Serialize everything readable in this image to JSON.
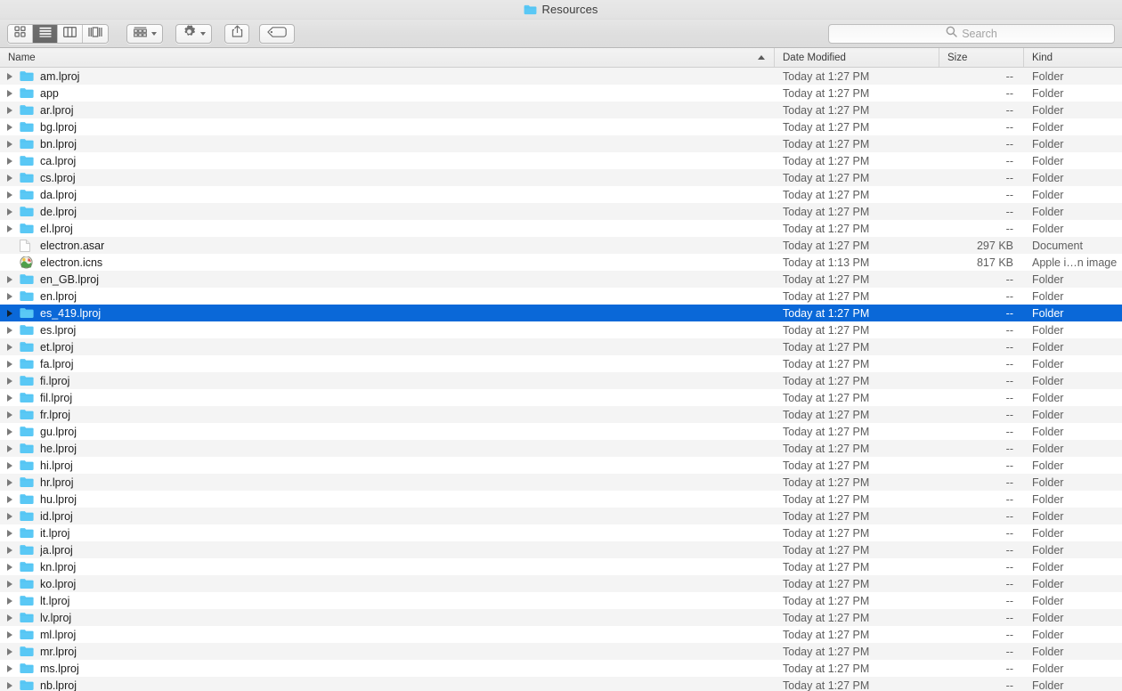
{
  "window": {
    "title": "Resources",
    "title_icon": "folder-icon"
  },
  "toolbar": {
    "view_modes": [
      {
        "name": "icon-view",
        "icon": "grid-icon",
        "active": false
      },
      {
        "name": "list-view",
        "icon": "list-icon",
        "active": true
      },
      {
        "name": "column-view",
        "icon": "columns-icon",
        "active": false
      },
      {
        "name": "gallery-view",
        "icon": "gallery-icon",
        "active": false
      }
    ],
    "arrange_label": "arrange-icon",
    "action_label": "gear-icon",
    "share_label": "share-icon",
    "tags_label": "tag-icon"
  },
  "search": {
    "placeholder": "Search",
    "value": "",
    "icon": "search-icon"
  },
  "columns": {
    "name": "Name",
    "date_modified": "Date Modified",
    "size": "Size",
    "kind": "Kind",
    "sort_by": "Name",
    "sort_direction": "ascending"
  },
  "colors": {
    "selection": "#0a68d8",
    "stripe": "#f4f4f4",
    "folder": "#5ac8f5",
    "toolbar": "#dfdfdf"
  },
  "rows": [
    {
      "name": "am.lproj",
      "date": "Today at 1:27 PM",
      "size": "--",
      "kind": "Folder",
      "icon": "folder-icon",
      "expandable": true,
      "selected": false
    },
    {
      "name": "app",
      "date": "Today at 1:27 PM",
      "size": "--",
      "kind": "Folder",
      "icon": "folder-icon",
      "expandable": true,
      "selected": false
    },
    {
      "name": "ar.lproj",
      "date": "Today at 1:27 PM",
      "size": "--",
      "kind": "Folder",
      "icon": "folder-icon",
      "expandable": true,
      "selected": false
    },
    {
      "name": "bg.lproj",
      "date": "Today at 1:27 PM",
      "size": "--",
      "kind": "Folder",
      "icon": "folder-icon",
      "expandable": true,
      "selected": false
    },
    {
      "name": "bn.lproj",
      "date": "Today at 1:27 PM",
      "size": "--",
      "kind": "Folder",
      "icon": "folder-icon",
      "expandable": true,
      "selected": false
    },
    {
      "name": "ca.lproj",
      "date": "Today at 1:27 PM",
      "size": "--",
      "kind": "Folder",
      "icon": "folder-icon",
      "expandable": true,
      "selected": false
    },
    {
      "name": "cs.lproj",
      "date": "Today at 1:27 PM",
      "size": "--",
      "kind": "Folder",
      "icon": "folder-icon",
      "expandable": true,
      "selected": false
    },
    {
      "name": "da.lproj",
      "date": "Today at 1:27 PM",
      "size": "--",
      "kind": "Folder",
      "icon": "folder-icon",
      "expandable": true,
      "selected": false
    },
    {
      "name": "de.lproj",
      "date": "Today at 1:27 PM",
      "size": "--",
      "kind": "Folder",
      "icon": "folder-icon",
      "expandable": true,
      "selected": false
    },
    {
      "name": "el.lproj",
      "date": "Today at 1:27 PM",
      "size": "--",
      "kind": "Folder",
      "icon": "folder-icon",
      "expandable": true,
      "selected": false
    },
    {
      "name": "electron.asar",
      "date": "Today at 1:27 PM",
      "size": "297 KB",
      "kind": "Document",
      "icon": "document-icon",
      "expandable": false,
      "selected": false
    },
    {
      "name": "electron.icns",
      "date": "Today at 1:13 PM",
      "size": "817 KB",
      "kind": "Apple i…n image",
      "icon": "icns-icon",
      "expandable": false,
      "selected": false
    },
    {
      "name": "en_GB.lproj",
      "date": "Today at 1:27 PM",
      "size": "--",
      "kind": "Folder",
      "icon": "folder-icon",
      "expandable": true,
      "selected": false
    },
    {
      "name": "en.lproj",
      "date": "Today at 1:27 PM",
      "size": "--",
      "kind": "Folder",
      "icon": "folder-icon",
      "expandable": true,
      "selected": false
    },
    {
      "name": "es_419.lproj",
      "date": "Today at 1:27 PM",
      "size": "--",
      "kind": "Folder",
      "icon": "folder-icon",
      "expandable": true,
      "selected": true
    },
    {
      "name": "es.lproj",
      "date": "Today at 1:27 PM",
      "size": "--",
      "kind": "Folder",
      "icon": "folder-icon",
      "expandable": true,
      "selected": false
    },
    {
      "name": "et.lproj",
      "date": "Today at 1:27 PM",
      "size": "--",
      "kind": "Folder",
      "icon": "folder-icon",
      "expandable": true,
      "selected": false
    },
    {
      "name": "fa.lproj",
      "date": "Today at 1:27 PM",
      "size": "--",
      "kind": "Folder",
      "icon": "folder-icon",
      "expandable": true,
      "selected": false
    },
    {
      "name": "fi.lproj",
      "date": "Today at 1:27 PM",
      "size": "--",
      "kind": "Folder",
      "icon": "folder-icon",
      "expandable": true,
      "selected": false
    },
    {
      "name": "fil.lproj",
      "date": "Today at 1:27 PM",
      "size": "--",
      "kind": "Folder",
      "icon": "folder-icon",
      "expandable": true,
      "selected": false
    },
    {
      "name": "fr.lproj",
      "date": "Today at 1:27 PM",
      "size": "--",
      "kind": "Folder",
      "icon": "folder-icon",
      "expandable": true,
      "selected": false
    },
    {
      "name": "gu.lproj",
      "date": "Today at 1:27 PM",
      "size": "--",
      "kind": "Folder",
      "icon": "folder-icon",
      "expandable": true,
      "selected": false
    },
    {
      "name": "he.lproj",
      "date": "Today at 1:27 PM",
      "size": "--",
      "kind": "Folder",
      "icon": "folder-icon",
      "expandable": true,
      "selected": false
    },
    {
      "name": "hi.lproj",
      "date": "Today at 1:27 PM",
      "size": "--",
      "kind": "Folder",
      "icon": "folder-icon",
      "expandable": true,
      "selected": false
    },
    {
      "name": "hr.lproj",
      "date": "Today at 1:27 PM",
      "size": "--",
      "kind": "Folder",
      "icon": "folder-icon",
      "expandable": true,
      "selected": false
    },
    {
      "name": "hu.lproj",
      "date": "Today at 1:27 PM",
      "size": "--",
      "kind": "Folder",
      "icon": "folder-icon",
      "expandable": true,
      "selected": false
    },
    {
      "name": "id.lproj",
      "date": "Today at 1:27 PM",
      "size": "--",
      "kind": "Folder",
      "icon": "folder-icon",
      "expandable": true,
      "selected": false
    },
    {
      "name": "it.lproj",
      "date": "Today at 1:27 PM",
      "size": "--",
      "kind": "Folder",
      "icon": "folder-icon",
      "expandable": true,
      "selected": false
    },
    {
      "name": "ja.lproj",
      "date": "Today at 1:27 PM",
      "size": "--",
      "kind": "Folder",
      "icon": "folder-icon",
      "expandable": true,
      "selected": false
    },
    {
      "name": "kn.lproj",
      "date": "Today at 1:27 PM",
      "size": "--",
      "kind": "Folder",
      "icon": "folder-icon",
      "expandable": true,
      "selected": false
    },
    {
      "name": "ko.lproj",
      "date": "Today at 1:27 PM",
      "size": "--",
      "kind": "Folder",
      "icon": "folder-icon",
      "expandable": true,
      "selected": false
    },
    {
      "name": "lt.lproj",
      "date": "Today at 1:27 PM",
      "size": "--",
      "kind": "Folder",
      "icon": "folder-icon",
      "expandable": true,
      "selected": false
    },
    {
      "name": "lv.lproj",
      "date": "Today at 1:27 PM",
      "size": "--",
      "kind": "Folder",
      "icon": "folder-icon",
      "expandable": true,
      "selected": false
    },
    {
      "name": "ml.lproj",
      "date": "Today at 1:27 PM",
      "size": "--",
      "kind": "Folder",
      "icon": "folder-icon",
      "expandable": true,
      "selected": false
    },
    {
      "name": "mr.lproj",
      "date": "Today at 1:27 PM",
      "size": "--",
      "kind": "Folder",
      "icon": "folder-icon",
      "expandable": true,
      "selected": false
    },
    {
      "name": "ms.lproj",
      "date": "Today at 1:27 PM",
      "size": "--",
      "kind": "Folder",
      "icon": "folder-icon",
      "expandable": true,
      "selected": false
    },
    {
      "name": "nb.lproj",
      "date": "Today at 1:27 PM",
      "size": "--",
      "kind": "Folder",
      "icon": "folder-icon",
      "expandable": true,
      "selected": false
    }
  ]
}
